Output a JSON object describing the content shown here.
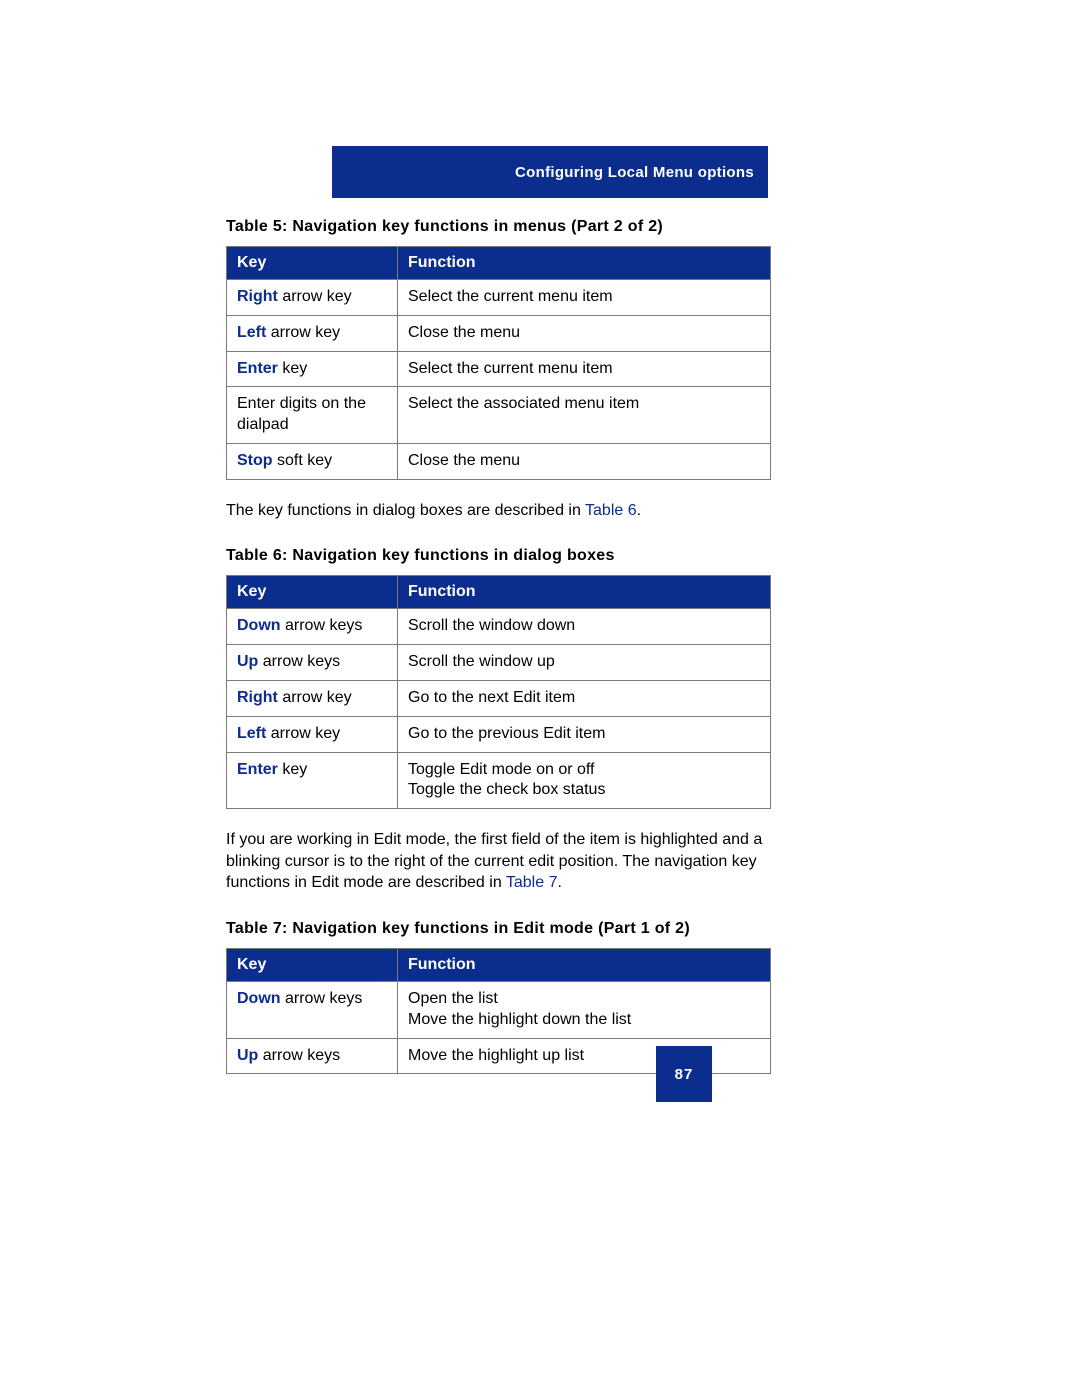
{
  "header": "Configuring Local Menu options",
  "page_number": "87",
  "table5": {
    "caption": "Table 5: Navigation key functions in menus (Part 2 of 2)",
    "head_key": "Key",
    "head_fn": "Function",
    "rows": {
      "r0": {
        "kb": "Right",
        "kr": " arrow key",
        "fn": "Select the current menu item"
      },
      "r1": {
        "kb": "Left",
        "kr": " arrow key",
        "fn": "Close the menu"
      },
      "r2": {
        "kb": "Enter",
        "kr": " key",
        "fn": "Select the current menu item"
      },
      "r3": {
        "kb": "",
        "kr": "Enter digits on the dialpad",
        "fn": "Select the associated menu item"
      },
      "r4": {
        "kb": "Stop",
        "kr": " soft key",
        "fn": "Close the menu"
      }
    }
  },
  "para1": {
    "pre": "The key functions in dialog boxes are described in ",
    "link": "Table 6",
    "post": "."
  },
  "table6": {
    "caption": "Table 6: Navigation key functions in dialog boxes",
    "head_key": "Key",
    "head_fn": "Function",
    "rows": {
      "r0": {
        "kb": "Down",
        "kr": " arrow keys",
        "fn": "Scroll the window down"
      },
      "r1": {
        "kb": "Up",
        "kr": " arrow keys",
        "fn": "Scroll the window up"
      },
      "r2": {
        "kb": "Right",
        "kr": " arrow key",
        "fn": "Go to the next Edit item"
      },
      "r3": {
        "kb": "Left",
        "kr": " arrow key",
        "fn": "Go to the previous Edit item"
      },
      "r4": {
        "kb": "Enter",
        "kr": " key",
        "fn": "Toggle Edit mode on or off\nToggle the check box status"
      }
    }
  },
  "para2": {
    "pre": "If you are working in Edit mode, the first field of the item is highlighted and a blinking cursor is to the right of the current edit position. The navigation key functions in Edit mode are described in ",
    "link": "Table 7",
    "post": "."
  },
  "table7": {
    "caption": "Table 7: Navigation key functions in Edit mode (Part 1 of 2)",
    "head_key": "Key",
    "head_fn": "Function",
    "rows": {
      "r0": {
        "kb": "Down",
        "kr": " arrow keys",
        "fn": "Open the list\nMove the highlight down the list"
      },
      "r1": {
        "kb": "Up",
        "kr": " arrow keys",
        "fn": "Move the highlight up list"
      }
    }
  }
}
